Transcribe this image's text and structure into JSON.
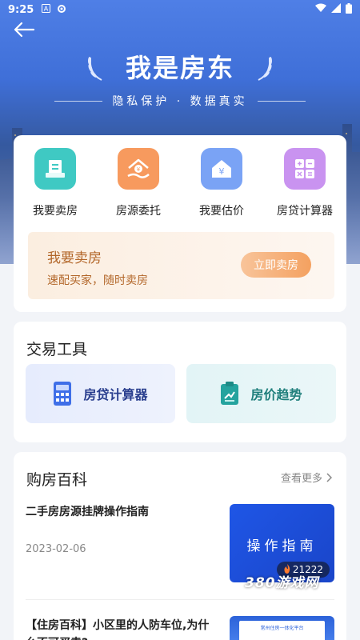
{
  "status_bar": {
    "time": "9:25",
    "icons": [
      "notification-a-icon",
      "settings-icon"
    ],
    "right_icons": [
      "wifi-icon",
      "signal-icon",
      "battery-icon"
    ]
  },
  "header": {
    "title": "我是房东",
    "subtitle": "隐私保护 · 数据真实"
  },
  "quick_actions": [
    {
      "label": "我要卖房",
      "icon": "sell-house-icon",
      "color": "#3fc9c3"
    },
    {
      "label": "房源委托",
      "icon": "entrust-house-icon",
      "color": "#f79a5e"
    },
    {
      "label": "我要估价",
      "icon": "valuation-icon",
      "color": "#7aa3f5"
    },
    {
      "label": "房贷计算器",
      "icon": "calculator-icon",
      "color": "#c993f0"
    }
  ],
  "banner": {
    "title": "我要卖房",
    "subtitle": "速配买家，随时卖房",
    "button": "立即卖房"
  },
  "tools": {
    "title": "交易工具",
    "items": [
      {
        "label": "房贷计算器",
        "icon": "calculator-icon"
      },
      {
        "label": "房价趋势",
        "icon": "clipboard-trend-icon"
      }
    ]
  },
  "wiki": {
    "title": "购房百科",
    "more": "查看更多",
    "articles": [
      {
        "title": "二手房房源挂牌操作指南",
        "date": "2023-02-06",
        "thumb_text": "操作指南",
        "views": "21222"
      },
      {
        "title": "【住房百科】小区里的人防车位,为什么不可买卖?",
        "thumb_text": "常州住房一体化平台"
      }
    ]
  },
  "watermark": "380游戏网"
}
